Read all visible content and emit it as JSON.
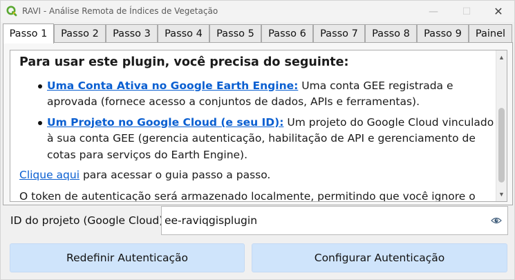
{
  "window": {
    "title": "RAVI - Análise Remota de Índices de Vegetação",
    "app_icon": "qgis-icon",
    "controls": {
      "minimize": "—",
      "maximize": "☐",
      "close": "✕"
    }
  },
  "tabs": [
    {
      "label": "Passo 1",
      "active": true
    },
    {
      "label": "Passo 2",
      "active": false
    },
    {
      "label": "Passo 3",
      "active": false
    },
    {
      "label": "Passo 4",
      "active": false
    },
    {
      "label": "Passo 5",
      "active": false
    },
    {
      "label": "Passo 6",
      "active": false
    },
    {
      "label": "Passo 7",
      "active": false
    },
    {
      "label": "Passo 8",
      "active": false
    },
    {
      "label": "Passo 9",
      "active": false
    },
    {
      "label": "Painel",
      "active": false
    }
  ],
  "content": {
    "heading": "Para usar este plugin, você precisa do seguinte:",
    "requirements": [
      {
        "link": "Uma Conta Ativa no Google Earth Engine:",
        "text": " Uma conta GEE registrada e aprovada (fornece acesso a conjuntos de dados, APIs e ferramentas)."
      },
      {
        "link": "Um Projeto no Google Cloud (e seu ID):",
        "text": " Um projeto do Google Cloud vinculado à sua conta GEE (gerencia autenticação, habilitação de API e gerenciamento de cotas para serviços do Earth Engine)."
      }
    ],
    "guide_link": "Clique aqui",
    "guide_text": " para acessar o guia passo a passo.",
    "token_text": "O token de autenticação será armazenado localmente, permitindo que você ignore o login do"
  },
  "project": {
    "label": "ID do projeto (Google Cloud):",
    "value": "ee-raviqgisplugin",
    "visibility_icon": "eye-icon"
  },
  "buttons": {
    "reset": "Redefinir Autenticação",
    "configure": "Configurar Autenticação"
  },
  "colors": {
    "link": "#0a5fd1",
    "button_bg": "#cfe4fb",
    "qgis_green": "#5aa832"
  }
}
